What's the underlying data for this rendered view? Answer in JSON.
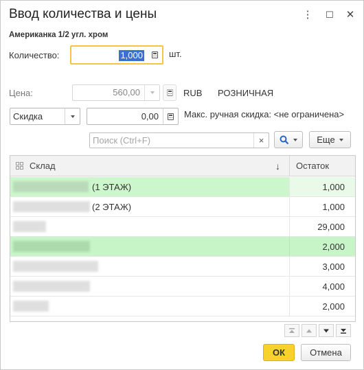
{
  "window": {
    "title": "Ввод количества и цены",
    "menu_glyph": "⋮",
    "maximize_glyph": "☐",
    "close_glyph": "✕"
  },
  "product": {
    "name": "Американка  1/2  угл. хром"
  },
  "quantity": {
    "label": "Количество:",
    "value": "1,000",
    "unit": "шт."
  },
  "price": {
    "label": "Цена:",
    "value": "560,00",
    "currency": "RUB",
    "price_type": "РОЗНИЧНАЯ"
  },
  "discount": {
    "type_value": "Скидка",
    "amount": "0,00",
    "max_text": "Макс. ручная скидка: <не ограничена>"
  },
  "search": {
    "placeholder": "Поиск (Ctrl+F)",
    "clear_glyph": "×",
    "more_label": "Еще"
  },
  "table": {
    "columns": {
      "warehouse": "Склад",
      "sort_glyph": "↓",
      "balance": "Остаток"
    },
    "rows": [
      {
        "name": "(1 ЭТАЖ)",
        "balance": "1,000"
      },
      {
        "name": "(2 ЭТАЖ)",
        "balance": "1,000"
      },
      {
        "name": "",
        "balance": "29,000"
      },
      {
        "name": "",
        "balance": "2,000"
      },
      {
        "name": "",
        "balance": "3,000"
      },
      {
        "name": "",
        "balance": "4,000"
      },
      {
        "name": "",
        "balance": "2,000"
      }
    ]
  },
  "footer": {
    "ok_label": "ОК",
    "cancel_label": "Отмена"
  },
  "colors": {
    "accent": "#f8d22c",
    "selection": "#3b6fd1",
    "row_highlight": "#c8f5c8"
  }
}
